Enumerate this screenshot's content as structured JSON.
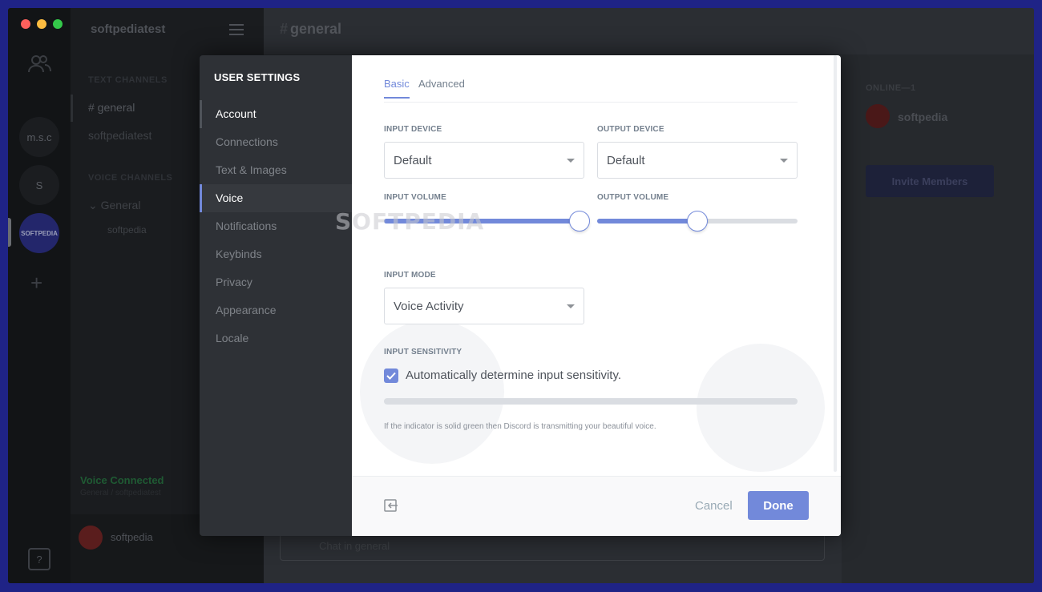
{
  "server": {
    "name": "softpediatest",
    "rail": [
      "m.s.c",
      "S",
      "SOFTPEDIA"
    ],
    "text_channels_header": "TEXT CHANNELS",
    "text_channels": [
      "# general",
      "softpediatest"
    ],
    "voice_channels_header": "VOICE CHANNELS",
    "voice_channel": "General",
    "voice_user": "softpedia",
    "voice_status": "Voice Connected",
    "voice_status_sub": "General / softpediatest",
    "user": "softpedia"
  },
  "chat": {
    "channel_title": "general",
    "input_placeholder": "Chat in general",
    "online_header": "ONLINE—1",
    "member": "softpedia",
    "invite_button": "Invite Members"
  },
  "settings": {
    "title": "USER SETTINGS",
    "nav": [
      "Account",
      "Connections",
      "Text & Images",
      "Voice",
      "Notifications",
      "Keybinds",
      "Privacy",
      "Appearance",
      "Locale"
    ],
    "selected_nav": "Voice",
    "tabs": {
      "basic": "Basic",
      "advanced": "Advanced"
    },
    "input_device": {
      "label": "INPUT DEVICE",
      "value": "Default"
    },
    "output_device": {
      "label": "OUTPUT DEVICE",
      "value": "Default"
    },
    "input_volume": {
      "label": "INPUT VOLUME",
      "fraction": 1.0
    },
    "output_volume": {
      "label": "OUTPUT VOLUME",
      "fraction": 0.5
    },
    "input_mode": {
      "label": "INPUT MODE",
      "value": "Voice Activity"
    },
    "input_sensitivity": {
      "label": "INPUT SENSITIVITY",
      "checkbox_label": "Automatically determine input sensitivity.",
      "checked": true,
      "hint": "If the indicator is solid green then Discord is transmitting your beautiful voice."
    },
    "footer": {
      "cancel": "Cancel",
      "done": "Done"
    }
  },
  "watermark": "SOFTPEDIA",
  "colors": {
    "accent": "#7289da",
    "desktop": "#1f2386"
  }
}
